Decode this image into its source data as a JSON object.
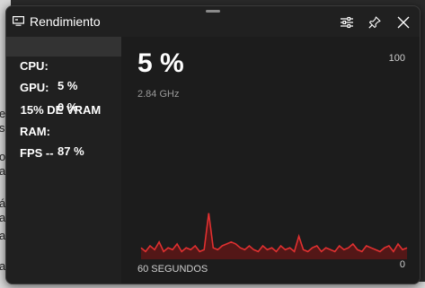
{
  "window": {
    "title": "Rendimiento",
    "icon": "monitor-icon",
    "buttons": [
      "settings-icon",
      "pin-icon",
      "close-icon"
    ]
  },
  "stats": [
    {
      "label": "CPU:",
      "value": "5 %",
      "selected": true
    },
    {
      "label": "GPU:",
      "value": "0 %",
      "selected": false
    },
    {
      "label": " 15% DE VRAM",
      "value": "",
      "selected": false
    },
    {
      "label": "RAM:",
      "value": "87 %",
      "selected": false
    },
    {
      "label": "FPS --",
      "value": "",
      "selected": false
    }
  ],
  "graph": {
    "big_value": "5 %",
    "frequency": "2.84 GHz",
    "max_label": "100",
    "min_label": "0",
    "x_label": "60 SEGUNDOS",
    "line_color": "#e03030",
    "fill_color": "#5a1717"
  },
  "chart_data": {
    "type": "area",
    "ylim": [
      0,
      100
    ],
    "series": [
      {
        "values": [
          6,
          4,
          7,
          5,
          9,
          4,
          6,
          5,
          8,
          4,
          6,
          5,
          7,
          4,
          5,
          24,
          6,
          5,
          7,
          8,
          9,
          8,
          6,
          5,
          7,
          5,
          4,
          7,
          5,
          6,
          4,
          7,
          5,
          6,
          4,
          12,
          5,
          4,
          6,
          7,
          4,
          6,
          5,
          4,
          7,
          5,
          6,
          8,
          5,
          4,
          7,
          6,
          5,
          4,
          6,
          7,
          4,
          8,
          5,
          6
        ]
      }
    ]
  },
  "backdrop": {
    "side_chars": [
      "e",
      "s",
      "o",
      "a",
      "á",
      "a",
      "a",
      "a"
    ]
  }
}
